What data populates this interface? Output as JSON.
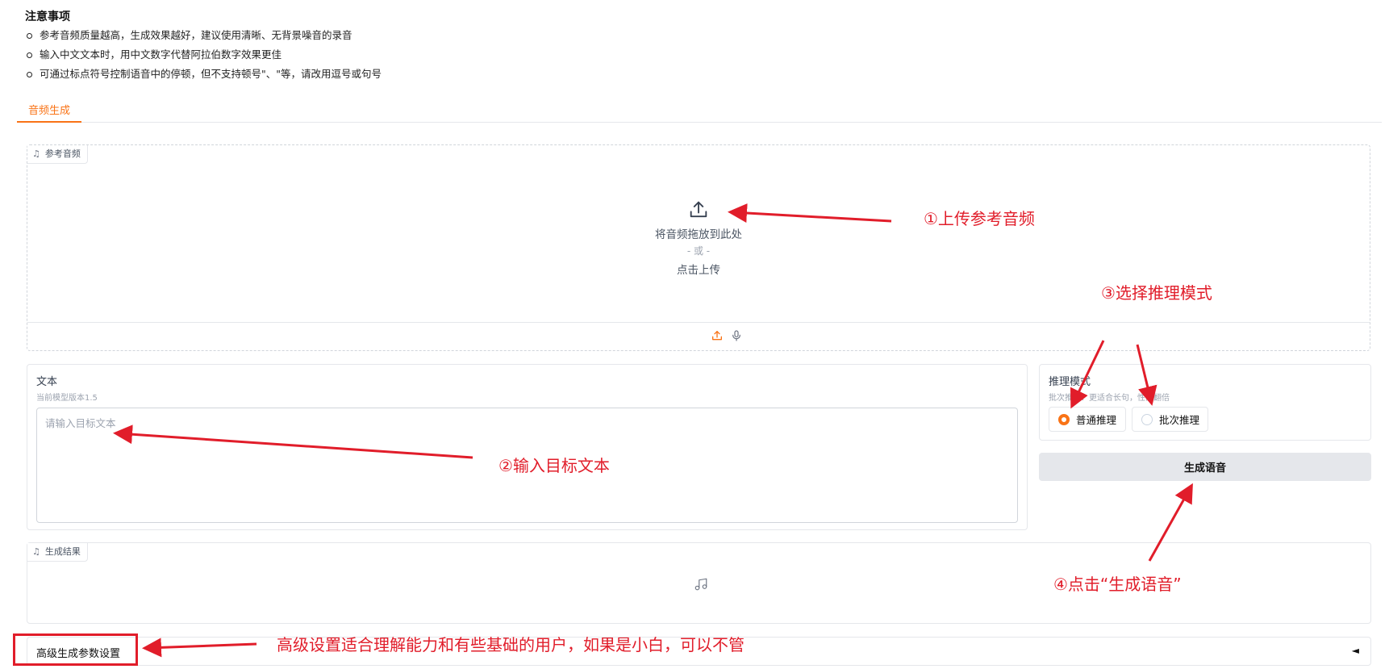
{
  "notes": {
    "title": "注意事项",
    "items": [
      "参考音频质量越高，生成效果越好，建议使用清晰、无背景噪音的录音",
      "输入中文文本时，用中文数字代替阿拉伯数字效果更佳",
      "可通过标点符号控制语音中的停顿，但不支持顿号\"、\"等，请改用逗号或句号"
    ]
  },
  "tabs": [
    {
      "label": "音频生成",
      "active": true
    }
  ],
  "reference_audio": {
    "label": "参考音频",
    "drop_text": "将音频拖放到此处",
    "or_text": "- 或 -",
    "click_text": "点击上传",
    "source_icons": [
      "upload-icon",
      "microphone-icon"
    ]
  },
  "text_input": {
    "label": "文本",
    "info": "当前模型版本1.5",
    "placeholder": "请输入目标文本",
    "value": ""
  },
  "inference_mode": {
    "label": "推理模式",
    "info": "批次推理：更适合长句，性能翻倍",
    "options": [
      {
        "label": "普通推理",
        "checked": true
      },
      {
        "label": "批次推理",
        "checked": false
      }
    ]
  },
  "generate_button": {
    "label": "生成语音"
  },
  "result": {
    "label": "生成结果",
    "icon": "music-note-icon"
  },
  "advanced": {
    "label": "高级生成参数设置",
    "toggle": "◄"
  },
  "annotations": {
    "upload": "①上传参考音频",
    "text": "②输入目标文本",
    "mode": "③选择推理模式",
    "generate": "④点击“生成语音”",
    "advanced": "高级设置适合理解能力和有些基础的用户，如果是小白，可以不管"
  },
  "colors": {
    "accent": "#f97316",
    "annotation": "#e11d2a",
    "button_bg": "#e5e7eb",
    "border": "#e5e7eb"
  }
}
